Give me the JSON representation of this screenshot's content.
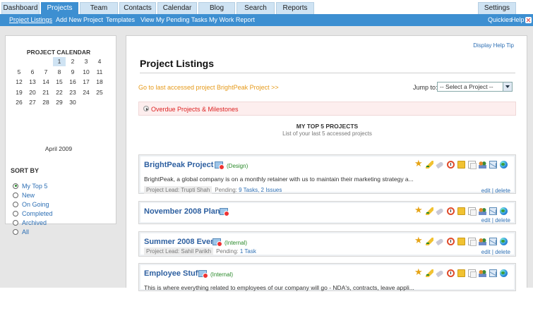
{
  "tabs": [
    {
      "label": "Dashboard",
      "active": false
    },
    {
      "label": "Projects",
      "active": true
    },
    {
      "label": "Team",
      "active": false
    },
    {
      "label": "Contacts",
      "active": false
    },
    {
      "label": "Calendar",
      "active": false
    },
    {
      "label": "Blog",
      "active": false
    },
    {
      "label": "Search",
      "active": false
    },
    {
      "label": "Reports",
      "active": false
    },
    {
      "label": "Settings",
      "active": false
    }
  ],
  "subnav": {
    "items": [
      "Project Listings",
      "Add New Project",
      "Templates",
      "View My Pending Tasks",
      "My Work Report"
    ],
    "quickies": "Quickies",
    "help": "Help"
  },
  "calendar": {
    "title": "PROJECT CALENDAR",
    "month": "April 2009",
    "today": "1",
    "days": [
      "1",
      "2",
      "3",
      "4",
      "5",
      "6",
      "7",
      "8",
      "9",
      "10",
      "11",
      "12",
      "13",
      "14",
      "15",
      "16",
      "17",
      "18",
      "19",
      "20",
      "21",
      "22",
      "23",
      "24",
      "25",
      "26",
      "27",
      "28",
      "29",
      "30"
    ]
  },
  "sort": {
    "title": "SORT BY",
    "options": [
      "My Top 5",
      "New",
      "On Going",
      "Completed",
      "Archived",
      "All"
    ],
    "selected": "My Top 5"
  },
  "main": {
    "help_tip": "Display Help Tip",
    "title": "Project Listings",
    "last_accessed": "Go to last accessed project BrightPeak Project >>",
    "jump_label": "Jump to:",
    "jump_value": "-- Select a Project --",
    "overdue": "Overdue Projects & Milestones",
    "top5_title": "MY TOP 5 PROJECTS",
    "top5_subtitle": "List of your last 5 accessed projects",
    "edit": "edit",
    "delete": "delete",
    "sep": "|"
  },
  "projects": [
    {
      "name": "BrightPeak Project",
      "tag": "(Design)",
      "description": "BrightPeak, a global company is on a monthly retainer with us to maintain their marketing strategy a...",
      "lead": "Project Lead: Trupti Shah",
      "pending_label": "Pending:",
      "pending_tasks": "9 Tasks,",
      "pending_issues": "2 Issues"
    },
    {
      "name": "November 2008 Plans",
      "tag": "",
      "description": "",
      "lead": "",
      "pending_label": "",
      "pending_tasks": "",
      "pending_issues": ""
    },
    {
      "name": "Summer 2008 Event",
      "tag": "(Internal)",
      "description": "",
      "lead": "Project Lead: Sahil Parikh",
      "pending_label": "Pending:",
      "pending_tasks": "1 Task",
      "pending_issues": ""
    },
    {
      "name": "Employee Stuff",
      "tag": "(Internal)",
      "description": "This is where everything related to employees of our company will go - NDA's, contracts, leave appli...",
      "lead": "",
      "pending_label": "",
      "pending_tasks": "",
      "pending_issues": ""
    }
  ],
  "project_icons": [
    "star-icon",
    "pencil-icon",
    "tag-icon",
    "clock-icon",
    "folder-icon",
    "documents-icon",
    "people-icon",
    "mail-icon",
    "globe-icon"
  ]
}
